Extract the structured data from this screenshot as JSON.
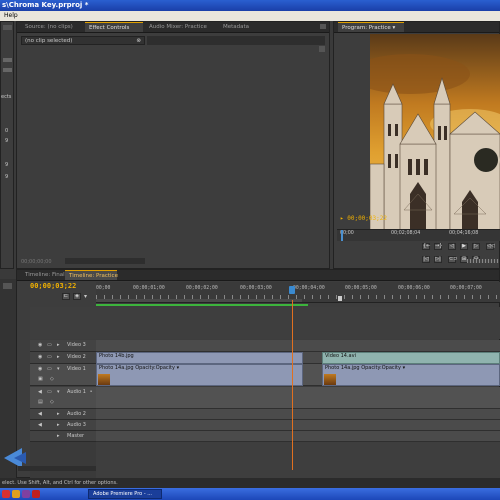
{
  "window": {
    "title": "s\\Chroma Key.prproj *"
  },
  "menu": {
    "help": "Help"
  },
  "source_panel": {
    "tabs": [
      "Source: (no clips)",
      "Effect Controls",
      "Audio Mixer: Practice",
      "Metadata"
    ],
    "clip_selector": "(no clip selected)",
    "timecode": "00;00;00;00"
  },
  "left_panel": {
    "label": "ects",
    "values": [
      "0",
      "9",
      "9",
      "9"
    ]
  },
  "program_monitor": {
    "tab": "Program: Practice",
    "timecode": "00;00;03;22",
    "ruler": [
      "00;00",
      "00;02;08;04",
      "00;04;16;08"
    ],
    "transport": [
      "{←",
      "→}",
      "◁",
      "▶",
      "▷",
      "◁◁"
    ],
    "transport2": [
      "|◁",
      "▷|",
      "⊂⊃",
      "⊞",
      "⊟"
    ]
  },
  "timeline": {
    "tabs": [
      "Timeline: Final",
      "Timeline: Practice"
    ],
    "timecode": "00;00;03;22",
    "ruler": [
      "00;00",
      "00;00;01;00",
      "00;00;02;00",
      "00;00;03;00",
      "00;00;04;00",
      "00;00;05;00",
      "00;00;06;00",
      "00;00;07;00"
    ],
    "tracks": {
      "video3": "Video 3",
      "video2": "Video 2",
      "video1": "Video 1",
      "audio1": "Audio 1",
      "audio2": "Audio 2",
      "audio3": "Audio 3",
      "master": "Master"
    },
    "clips": {
      "v2_a": "Photo 14b.jpg",
      "v2_b": "Video 14.avi",
      "v1_a": "Photo 14a.jpg  Opacity:Opacity ▾",
      "v1_b": "Photo 14a.jpg  Opacity:Opacity ▾"
    }
  },
  "status": "elect. Use Shift, Alt, and Ctrl for other options.",
  "taskbar": {
    "app_button": "Adobe Premiere Pro - ..."
  },
  "colors": {
    "accent": "#f0b000",
    "titlebar": "#2a5fd0",
    "playhead": "#e07020"
  }
}
